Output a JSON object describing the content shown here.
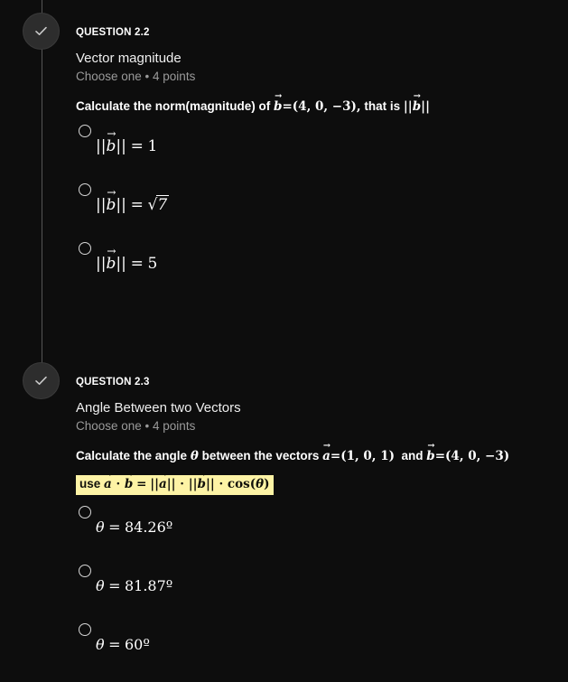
{
  "theme": {
    "background": "#0d0d0d",
    "text_primary": "#ffffff",
    "text_muted": "#9a9a9a",
    "timeline_line": "#555555",
    "marker_fill": "#2d2d2d",
    "highlight_background": "#fdf3a5",
    "highlight_text": "#10100a",
    "radio_border": "#d6d6d6"
  },
  "questions": [
    {
      "id": "question-22",
      "status_icon": "check-icon",
      "label": "QUESTION 2.2",
      "title": "Vector magnitude",
      "meta": "Choose one • 4 points",
      "prompt_text": "Calculate the norm(magnitude) of b⃗ = (4, 0, −3), that is ||b⃗||",
      "prompt_parts": {
        "lead": "Calculate the norm(magnitude) of",
        "vector_name": "b",
        "equals": "=",
        "components": "(4, 0, −3),",
        "tail": "that is",
        "norm": "||b⃗||"
      },
      "options": [
        {
          "text": "||b⃗|| = 1",
          "value_label": "1",
          "selected": false
        },
        {
          "text": "||b⃗|| = √7",
          "value_label": "√7",
          "selected": false
        },
        {
          "text": "||b⃗|| = 5",
          "value_label": "5",
          "selected": false
        }
      ]
    },
    {
      "id": "question-23",
      "status_icon": "check-icon",
      "label": "QUESTION 2.3",
      "title": "Angle Between two Vectors",
      "meta": "Choose one • 4 points",
      "prompt_text": "Calculate the angle θ between the vectors a⃗ = (1, 0, 1)  and  b⃗ = (4, 0, −3)",
      "prompt_parts": {
        "lead": "Calculate the angle",
        "theta": "θ",
        "middle": "between the vectors",
        "vector_a": "a",
        "a_components": "(1, 0, 1)",
        "and": "and",
        "vector_b": "b",
        "b_components": "(4, 0, −3)"
      },
      "hint": {
        "highlighted": true,
        "text": "use a⃗ · b⃗ = ||a⃗|| · ||b⃗|| · cos(θ)",
        "lead": "use"
      },
      "options": [
        {
          "text": "θ = 84.26º",
          "value_label": "84.26º",
          "selected": false
        },
        {
          "text": "θ = 81.87º",
          "value_label": "81.87º",
          "selected": false
        },
        {
          "text": "θ = 60º",
          "value_label": "60º",
          "selected": false
        }
      ]
    }
  ]
}
